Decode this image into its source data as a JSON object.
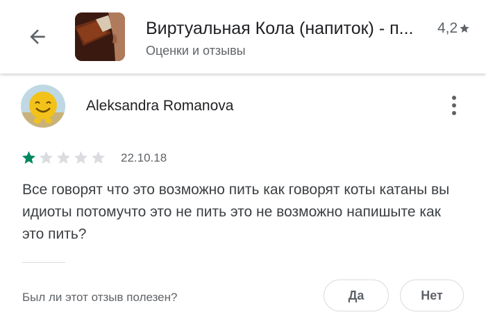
{
  "header": {
    "back_icon": "arrow-back-icon",
    "app_icon": "cola-drinking-icon",
    "app_title": "Виртуальная Кола (напиток) - п...",
    "subtitle": "Оценки и отзывы",
    "rating": "4,2",
    "rating_icon": "star-icon"
  },
  "review": {
    "avatar_icon": "smiley-avatar",
    "author": "Aleksandra Romanova",
    "more_icon": "more-vert-icon",
    "rating_value": 1,
    "rating_max": 5,
    "date": "22.10.18",
    "text": "Все говорят что это возможно пить как говорят коты катаны вы идиоты потомучто это не пить это не возможно напишыте как это пить?",
    "helpful_question": "Был ли этот отзыв полезен?",
    "yes_label": "Да",
    "no_label": "Нет"
  },
  "colors": {
    "star_filled": "#01875f",
    "star_empty": "#dadce0",
    "text_secondary": "#5f6368"
  }
}
